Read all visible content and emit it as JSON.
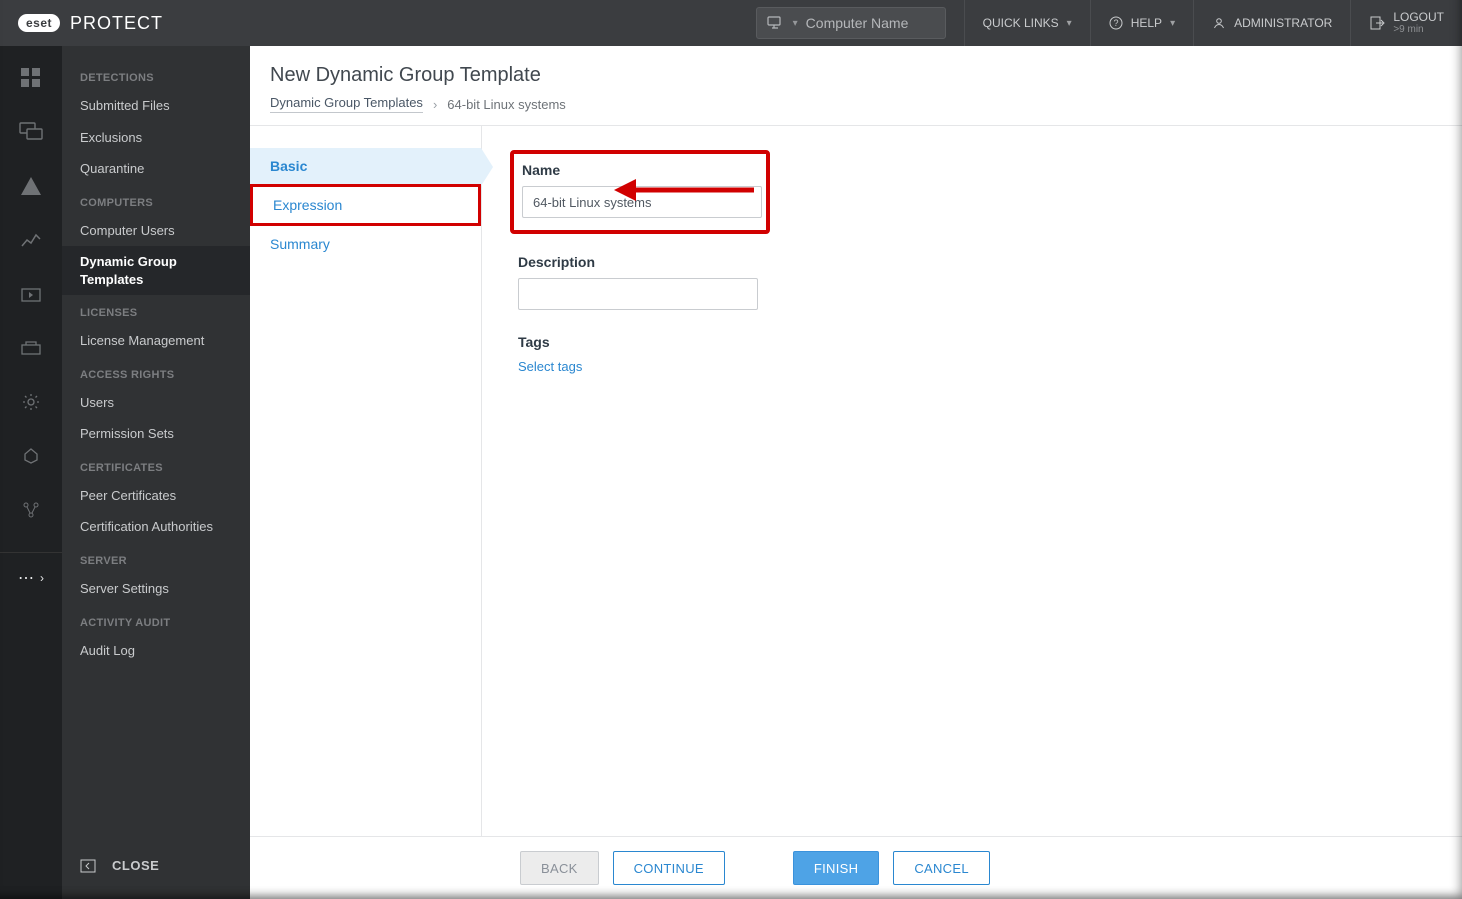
{
  "brand": {
    "eset": "eset",
    "product": "PROTECT"
  },
  "topbar": {
    "search_placeholder": "Computer Name",
    "quick_links": "QUICK LINKS",
    "help": "HELP",
    "admin": "ADMINISTRATOR",
    "logout": "LOGOUT",
    "logout_sub": ">9 min"
  },
  "sidebar": {
    "close_label": "CLOSE",
    "groups": [
      {
        "title": "DETECTIONS",
        "items": [
          "Submitted Files",
          "Exclusions",
          "Quarantine"
        ]
      },
      {
        "title": "COMPUTERS",
        "items": [
          "Computer Users",
          "Dynamic Group Templates"
        ]
      },
      {
        "title": "LICENSES",
        "items": [
          "License Management"
        ]
      },
      {
        "title": "ACCESS RIGHTS",
        "items": [
          "Users",
          "Permission Sets"
        ]
      },
      {
        "title": "CERTIFICATES",
        "items": [
          "Peer Certificates",
          "Certification Authorities"
        ]
      },
      {
        "title": "SERVER",
        "items": [
          "Server Settings"
        ]
      },
      {
        "title": "ACTIVITY AUDIT",
        "items": [
          "Audit Log"
        ]
      }
    ],
    "active": "Dynamic Group Templates"
  },
  "page": {
    "title": "New Dynamic Group Template",
    "breadcrumb_root": "Dynamic Group Templates",
    "breadcrumb_leaf": "64-bit Linux systems"
  },
  "wizard": {
    "steps": [
      "Basic",
      "Expression",
      "Summary"
    ],
    "active": "Basic",
    "highlight": "Expression"
  },
  "form": {
    "name_label": "Name",
    "name_value": "64-bit Linux systems",
    "desc_label": "Description",
    "desc_value": "",
    "tags_label": "Tags",
    "tags_link": "Select tags"
  },
  "buttons": {
    "back": "BACK",
    "continue": "CONTINUE",
    "finish": "FINISH",
    "cancel": "CANCEL"
  }
}
